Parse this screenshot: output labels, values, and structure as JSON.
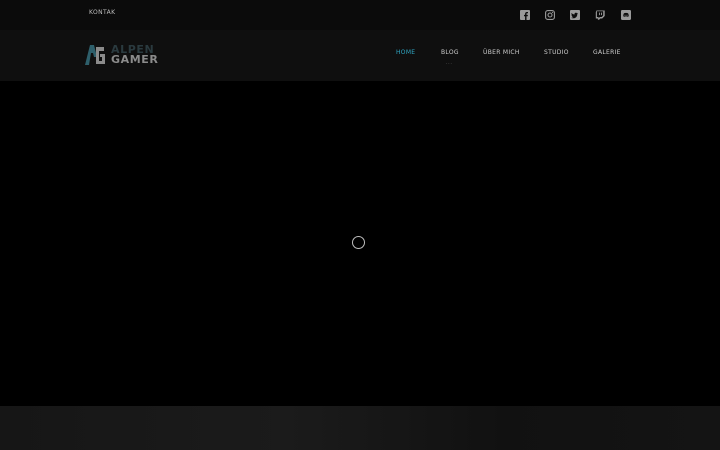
{
  "topbar": {
    "contact_link": "KONTAK",
    "social_icons": [
      "facebook-icon",
      "instagram-icon",
      "twitter-icon",
      "twitch-icon",
      "discord-icon"
    ]
  },
  "brand": {
    "line1": "ALPEN",
    "line2": "GAMER",
    "colors": {
      "accent": "#2fa7c4",
      "logo_dark": "#2a3a3f",
      "logo_grey": "#8b8b8b"
    }
  },
  "nav": {
    "items": [
      {
        "label": "HOME",
        "active": true
      },
      {
        "label": "BLOG",
        "active": false
      },
      {
        "label": "ÜBER MICH",
        "active": false
      },
      {
        "label": "STUDIO",
        "active": false
      },
      {
        "label": "GALERIE",
        "active": false
      }
    ],
    "blog_submenu_indicator": "···"
  },
  "hero": {
    "loading_icon": "spinner-icon"
  }
}
